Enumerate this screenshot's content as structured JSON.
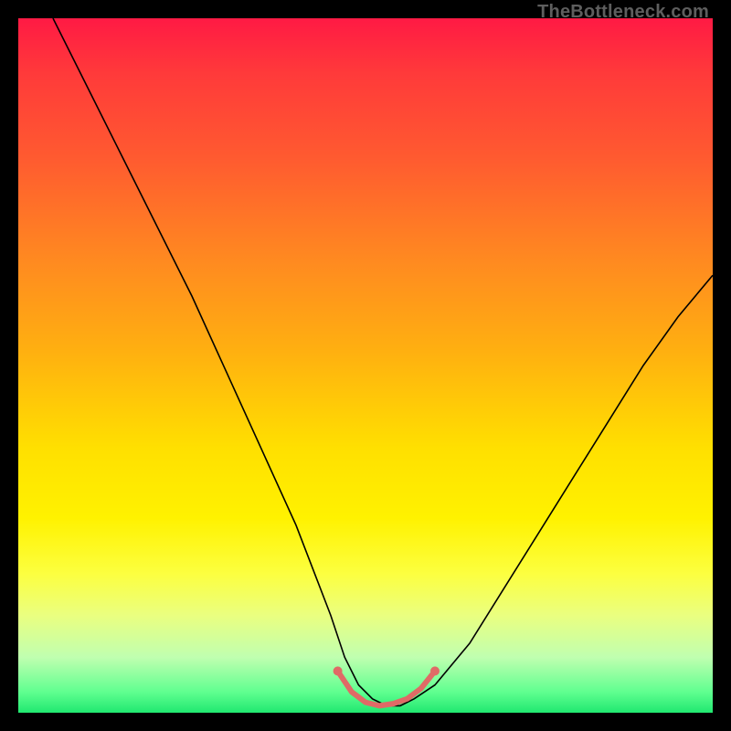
{
  "watermark": "TheBottleneck.com",
  "chart_data": {
    "type": "line",
    "title": "",
    "xlabel": "",
    "ylabel": "",
    "x_range": [
      0,
      100
    ],
    "y_range": [
      0,
      100
    ],
    "series": [
      {
        "name": "curve",
        "stroke": "#000000",
        "stroke_width": 1.6,
        "x": [
          5,
          10,
          15,
          20,
          25,
          30,
          35,
          40,
          45,
          47,
          49,
          51,
          53,
          55,
          57,
          60,
          65,
          70,
          75,
          80,
          85,
          90,
          95,
          100
        ],
        "y": [
          100,
          90,
          80,
          70,
          60,
          49,
          38,
          27,
          14,
          8,
          4,
          2,
          1,
          1,
          2,
          4,
          10,
          18,
          26,
          34,
          42,
          50,
          57,
          63
        ]
      },
      {
        "name": "bottom-highlight",
        "stroke": "#e06a66",
        "stroke_width": 6,
        "x": [
          46,
          48,
          50,
          52,
          54,
          56,
          58,
          60
        ],
        "y": [
          6,
          3,
          1.5,
          1,
          1.3,
          2,
          3.5,
          6
        ]
      }
    ],
    "gradient_stops": [
      {
        "pos": 0.0,
        "color": "#ff1a44"
      },
      {
        "pos": 0.62,
        "color": "#ffe000"
      },
      {
        "pos": 1.0,
        "color": "#20e870"
      }
    ]
  }
}
